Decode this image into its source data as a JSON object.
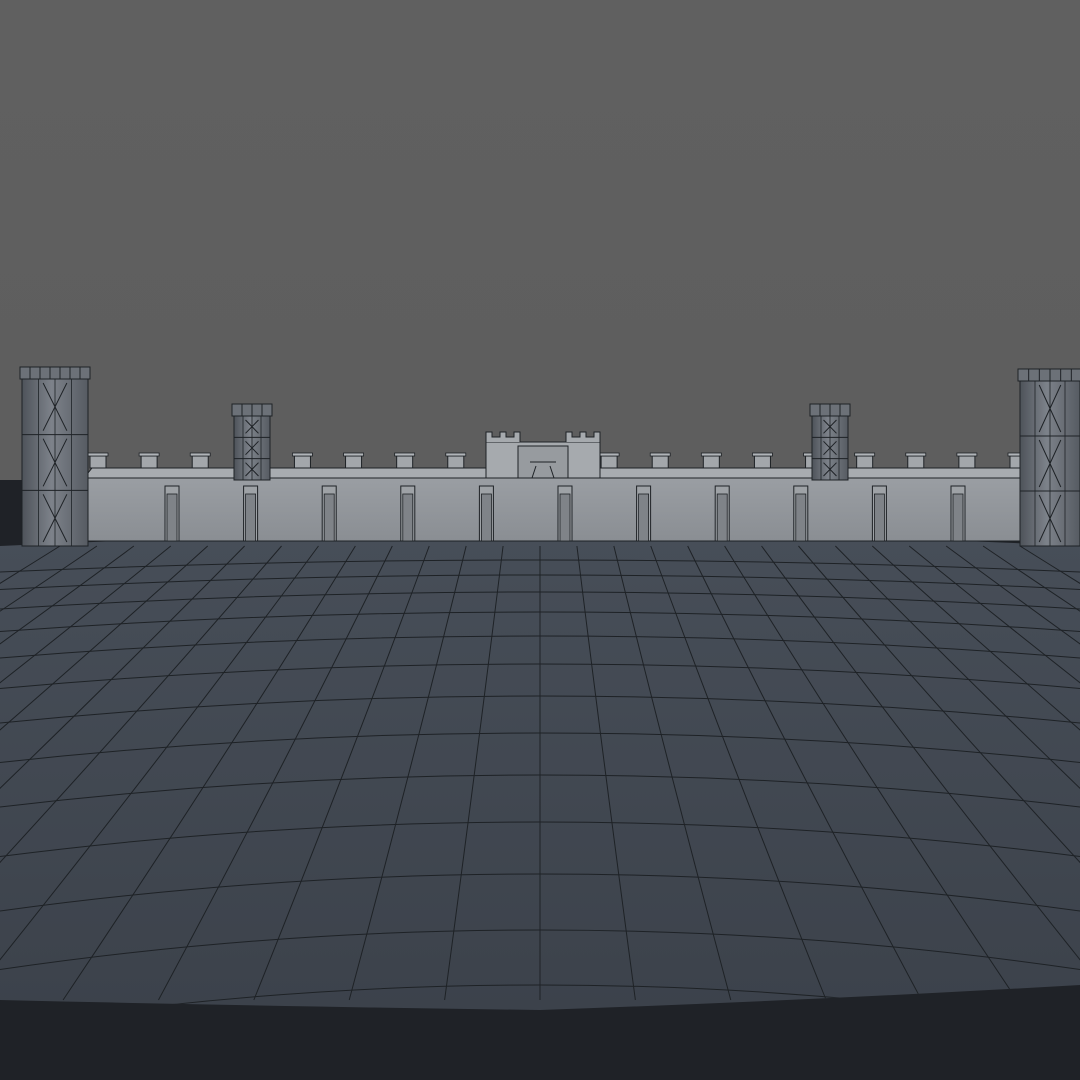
{
  "scene": {
    "kind": "3d-viewport-render",
    "subject": "castle-wall-wireframe",
    "colors": {
      "background": "#5f5f5f",
      "ground": "#414851",
      "ground_edge": "#1f2227",
      "wireframe": "#1e2226",
      "wall": "#8c9095",
      "wall_light": "#a3a7ab",
      "tower": "#737880",
      "tower_dark": "#4c5157"
    },
    "towers": [
      "corner-tower-left",
      "inner-tower-left",
      "inner-tower-right",
      "corner-tower-right"
    ],
    "buttress_count": 11,
    "merlon_count": 19
  }
}
